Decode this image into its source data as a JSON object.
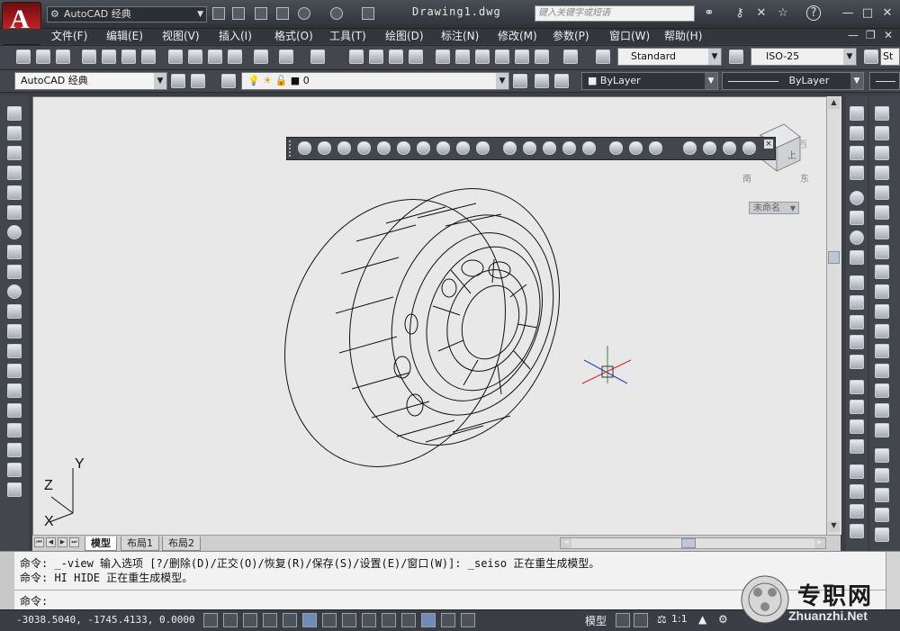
{
  "titlebar": {
    "workspace": "AutoCAD 经典",
    "document_title": "Drawing1.dwg",
    "search_placeholder": "键入关键字或短语",
    "help_label": "?",
    "app_letter": "A"
  },
  "menu": [
    "文件(F)",
    "编辑(E)",
    "视图(V)",
    "插入(I)",
    "格式(O)",
    "工具(T)",
    "绘图(D)",
    "标注(N)",
    "修改(M)",
    "参数(P)",
    "窗口(W)",
    "帮助(H)"
  ],
  "toolbar1": {
    "text_style": "Standard",
    "dim_style": "ISO-25",
    "extra_style": "St"
  },
  "toolbar2": {
    "workspace": "AutoCAD 经典",
    "layer": "0",
    "color": "ByLayer",
    "linetype": "ByLayer"
  },
  "viewcube": {
    "top_label": "上",
    "south_label": "南",
    "east_label": "东",
    "west_label": "西",
    "ucs_label": "未命名"
  },
  "ucs_icon": {
    "x": "X",
    "y": "Y",
    "z": "Z"
  },
  "layout_tabs": [
    "模型",
    "布局1",
    "布局2"
  ],
  "command_lines": [
    "命令: _-view 输入选项 [?/删除(D)/正交(O)/恢复(R)/保存(S)/设置(E)/窗口(W)]: _seiso 正在重生成模型。",
    "命令: HI HIDE 正在重生成模型。"
  ],
  "command_prompt": "命令:",
  "status": {
    "coordinates": "-3038.5040, -1745.4133, 0.0000",
    "model_label": "模型",
    "annotation_scale": "1:1"
  },
  "watermark": {
    "text": "专职网",
    "url": "Zhuanzhi.Net"
  },
  "colors": {
    "accent_red": "#c21f23",
    "canvas_bg": "#e8e8e8",
    "ui_dark": "#43474d"
  }
}
